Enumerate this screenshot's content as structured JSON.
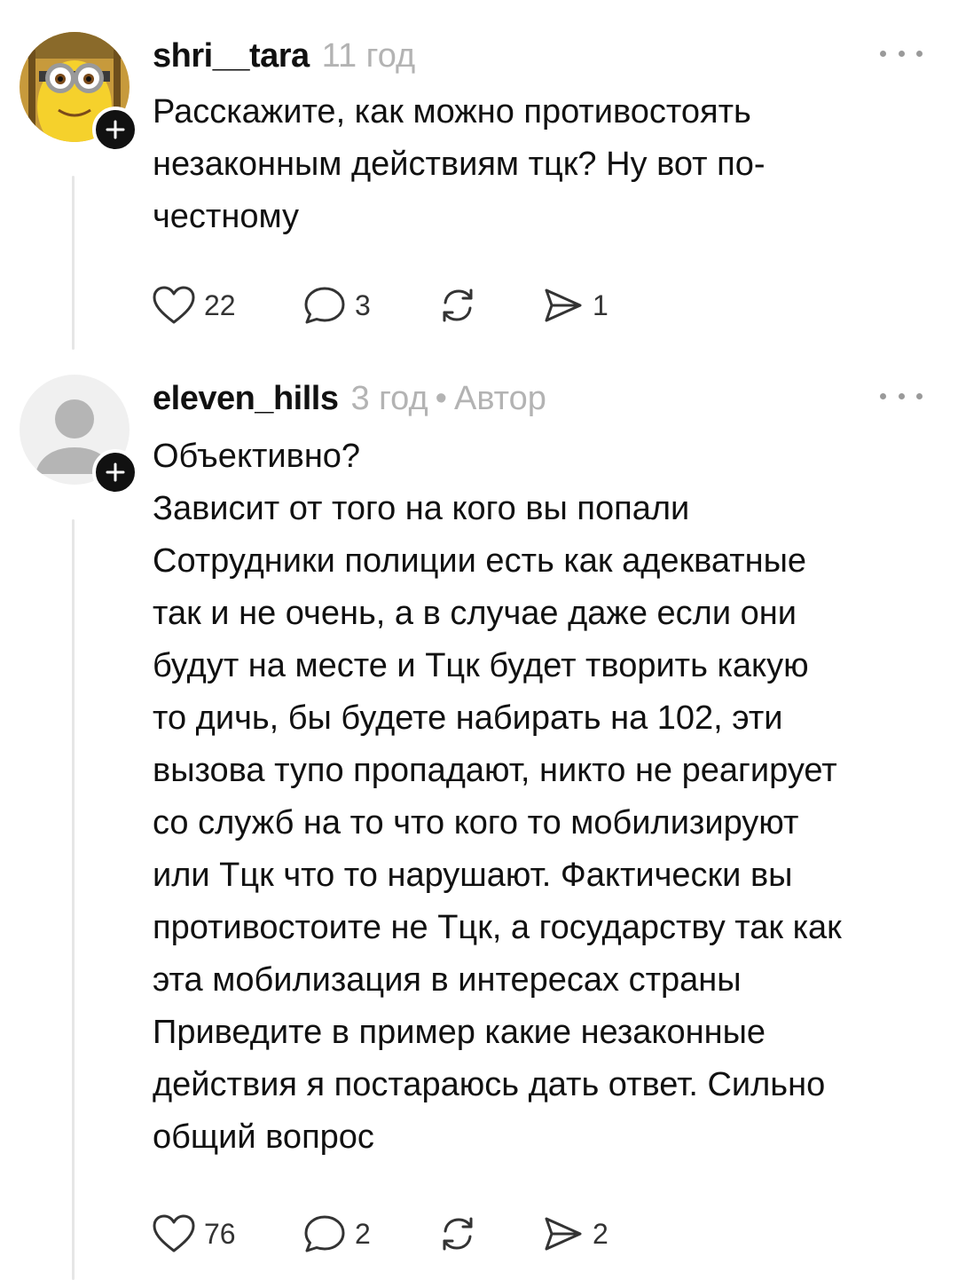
{
  "comments": [
    {
      "username": "shri__tara",
      "time": "11 год",
      "role": "",
      "lines": [
        "Расскажите, как можно противостоять",
        "незаконным действиям тцк? Ну вот по-",
        "честному"
      ],
      "likes": "22",
      "replies": "3",
      "reposts": "",
      "shares": "1",
      "avatar_icon": "minion-avatar",
      "badge_icon": "plus-icon"
    },
    {
      "username": "eleven_hills",
      "time": "3 год",
      "role": "Автор",
      "lines": [
        "Объективно?",
        "Зависит от того на кого вы попали",
        "Сотрудники полиции есть как адекватные",
        "так и не очень, а в случае даже если они",
        "будут на месте и Тцк будет творить какую",
        "то дичь, бы будете набирать на 102, эти",
        "вызова тупо пропадают, никто не реагирует",
        "со служб на то что кого то мобилизируют",
        "или Тцк что то нарушают. Фактически вы",
        "противостоите не Тцк, а государству так как",
        "эта мобилизация в интересах страны",
        "Приведите в пример какие незаконные",
        "действия я постараюсь дать ответ. Сильно",
        "общий вопрос"
      ],
      "likes": "76",
      "replies": "2",
      "reposts": "",
      "shares": "2",
      "avatar_icon": "default-user-avatar",
      "badge_icon": "plus-icon"
    }
  ],
  "colors": {
    "text": "#111111",
    "meta": "#b3b3b3",
    "icon": "#333333",
    "thread_line": "#e6e6e6"
  }
}
